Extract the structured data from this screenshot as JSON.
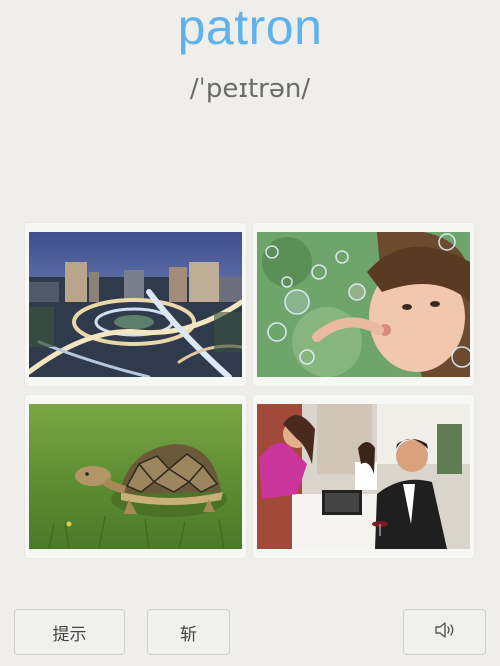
{
  "word": "patron",
  "phonetic": "/ˈpeɪtrən/",
  "choices": [
    {
      "icon": "city-interchange-photo"
    },
    {
      "icon": "girl-blowing-bubbles-photo"
    },
    {
      "icon": "tortoise-on-grass-photo"
    },
    {
      "icon": "restaurant-customers-photo"
    }
  ],
  "buttons": {
    "hint_label": "提示",
    "cut_label": "斩",
    "sound_icon": "speaker-icon"
  }
}
